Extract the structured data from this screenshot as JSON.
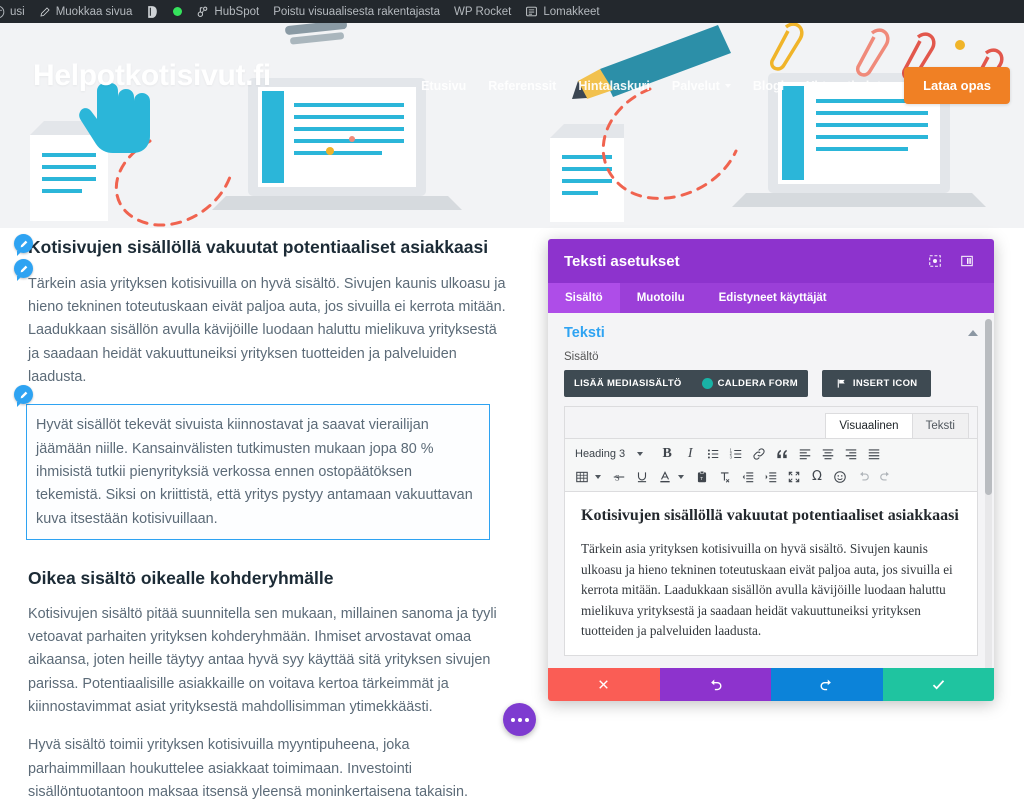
{
  "adminbar": {
    "items": [
      {
        "label": "usi",
        "icon": "wordpress-logo-clipped"
      },
      {
        "label": "Muokkaa sivua",
        "icon": "pencil-icon"
      },
      {
        "label": "",
        "icon": "yoast-seo-icon"
      },
      {
        "label": "",
        "icon": "status-dot-green"
      },
      {
        "label": "HubSpot",
        "icon": "hubspot-icon"
      },
      {
        "label": "Poistu visuaalisesta rakentajasta",
        "icon": ""
      },
      {
        "label": "WP Rocket",
        "icon": ""
      },
      {
        "label": "Lomakkeet",
        "icon": "forms-icon"
      }
    ]
  },
  "site": {
    "logo": "Helpotkotisivut.fi",
    "nav": [
      {
        "label": "Etusivu",
        "has_caret": false
      },
      {
        "label": "Referenssit",
        "has_caret": false
      },
      {
        "label": "Hintalaskuri",
        "has_caret": false
      },
      {
        "label": "Palvelut",
        "has_caret": true
      },
      {
        "label": "Blogi",
        "has_caret": false
      },
      {
        "label": "Yhteystiedot",
        "has_caret": false
      }
    ],
    "cta_label": "Lataa opas",
    "cta_color": "#f08024"
  },
  "article": {
    "heading_1": "Kotisivujen sisällöllä vakuutat potentiaaliset asiakkaasi",
    "paragraph_1": "Tärkein asia yrityksen kotisivuilla on hyvä sisältö. Sivujen kaunis ulkoasu ja hieno tekninen toteutuskaan eivät paljoa auta, jos sivuilla ei kerrota mitään. Laadukkaan sisällön avulla kävijöille luodaan haluttu mielikuva yrityksestä ja saadaan heidät vakuuttuneiksi yrityksen tuotteiden ja palveluiden laadusta.",
    "paragraph_2_highlighted": "Hyvät sisällöt tekevät sivuista kiinnostavat ja saavat vierailijan jäämään niille. Kansainvälisten tutkimusten mukaan jopa 80 % ihmisistä tutkii pienyrityksiä verkossa ennen ostopäätöksen tekemistä. Siksi on kriittistä, että yritys pystyy antamaan vakuuttavan kuva itsestään kotisivuillaan.",
    "heading_2": "Oikea sisältö oikealle kohderyhmälle",
    "paragraph_3": "Kotisivujen sisältö pitää suunnitella sen mukaan, millainen sanoma ja tyyli vetoavat parhaiten yrityksen kohderyhmään. Ihmiset arvostavat omaa aikaansa, joten heille täytyy antaa hyvä syy käyttää sitä yrityksen sivujen parissa. Potentiaalisille asiakkaille on voitava kertoa tärkeimmät ja kiinnostavimmat asiat yrityksestä mahdollisimman ytimekkäästi.",
    "paragraph_4": "Hyvä sisältö toimii yrityksen kotisivuilla myyntipuheena, joka parhaimmillaan houkuttelee asiakkaat toimimaan. Investointi sisällöntuotantoon maksaa itsensä yleensä moninkertaisena takaisin.",
    "highlight_border_color": "#2ea3f2"
  },
  "fab": {
    "icon": "ellipsis-icon",
    "color": "#7e3bd0"
  },
  "modal": {
    "title": "Teksti asetukset",
    "header_color": "#8d33cd",
    "header_icons": [
      {
        "name": "expand-icon"
      },
      {
        "name": "layout-columns-icon"
      }
    ],
    "tabs": [
      {
        "label": "Sisältö",
        "active": true
      },
      {
        "label": "Muotoilu",
        "active": false
      },
      {
        "label": "Edistyneet käyttäjät",
        "active": false
      }
    ],
    "section": {
      "title": "Teksti",
      "title_color": "#2ea3f2",
      "collapse_icon": "chevron-up-icon",
      "field_label": "Sisältö"
    },
    "buttons": {
      "add_media": "Lisää mediasisältö",
      "caldera_form": "Caldera Form",
      "insert_icon": "Insert Icon"
    },
    "editor": {
      "tabs": [
        {
          "label": "Visuaalinen",
          "active": true
        },
        {
          "label": "Teksti",
          "active": false
        }
      ],
      "format_select": "Heading 3",
      "toolbar_row1": [
        "bold-icon",
        "italic-icon",
        "bullet-list-icon",
        "numbered-list-icon",
        "link-icon",
        "blockquote-icon",
        "align-left-icon",
        "align-center-icon",
        "align-right-icon",
        "align-justify-icon"
      ],
      "toolbar_row2": [
        "table-icon",
        "strikethrough-icon",
        "underline-icon",
        "text-color-icon",
        "paste-as-text-icon",
        "clear-formatting-icon",
        "outdent-icon",
        "indent-icon",
        "fullscreen-icon",
        "special-character-icon",
        "emoji-icon",
        "undo-icon",
        "redo-icon"
      ],
      "content_heading": "Kotisivujen sisällöllä vakuutat potentiaaliset asiakkaasi",
      "content_paragraph": "Tärkein asia yrityksen kotisivuilla on hyvä sisältö. Sivujen kaunis ulkoasu ja hieno tekninen toteutuskaan eivät paljoa auta, jos sivuilla ei kerrota mitään. Laadukkaan sisällön avulla kävijöille luodaan haluttu mielikuva yrityksestä ja saadaan heidät vakuuttuneiksi yrityksen tuotteiden ja palveluiden laadusta."
    },
    "footer": [
      {
        "name": "cancel-button",
        "icon": "close-icon",
        "color": "#fa5d55"
      },
      {
        "name": "undo-button",
        "icon": "undo-icon",
        "color": "#8d33cd"
      },
      {
        "name": "redo-button",
        "icon": "redo-icon",
        "color": "#0c83d9"
      },
      {
        "name": "save-button",
        "icon": "check-icon",
        "color": "#1fc4a0"
      }
    ]
  }
}
